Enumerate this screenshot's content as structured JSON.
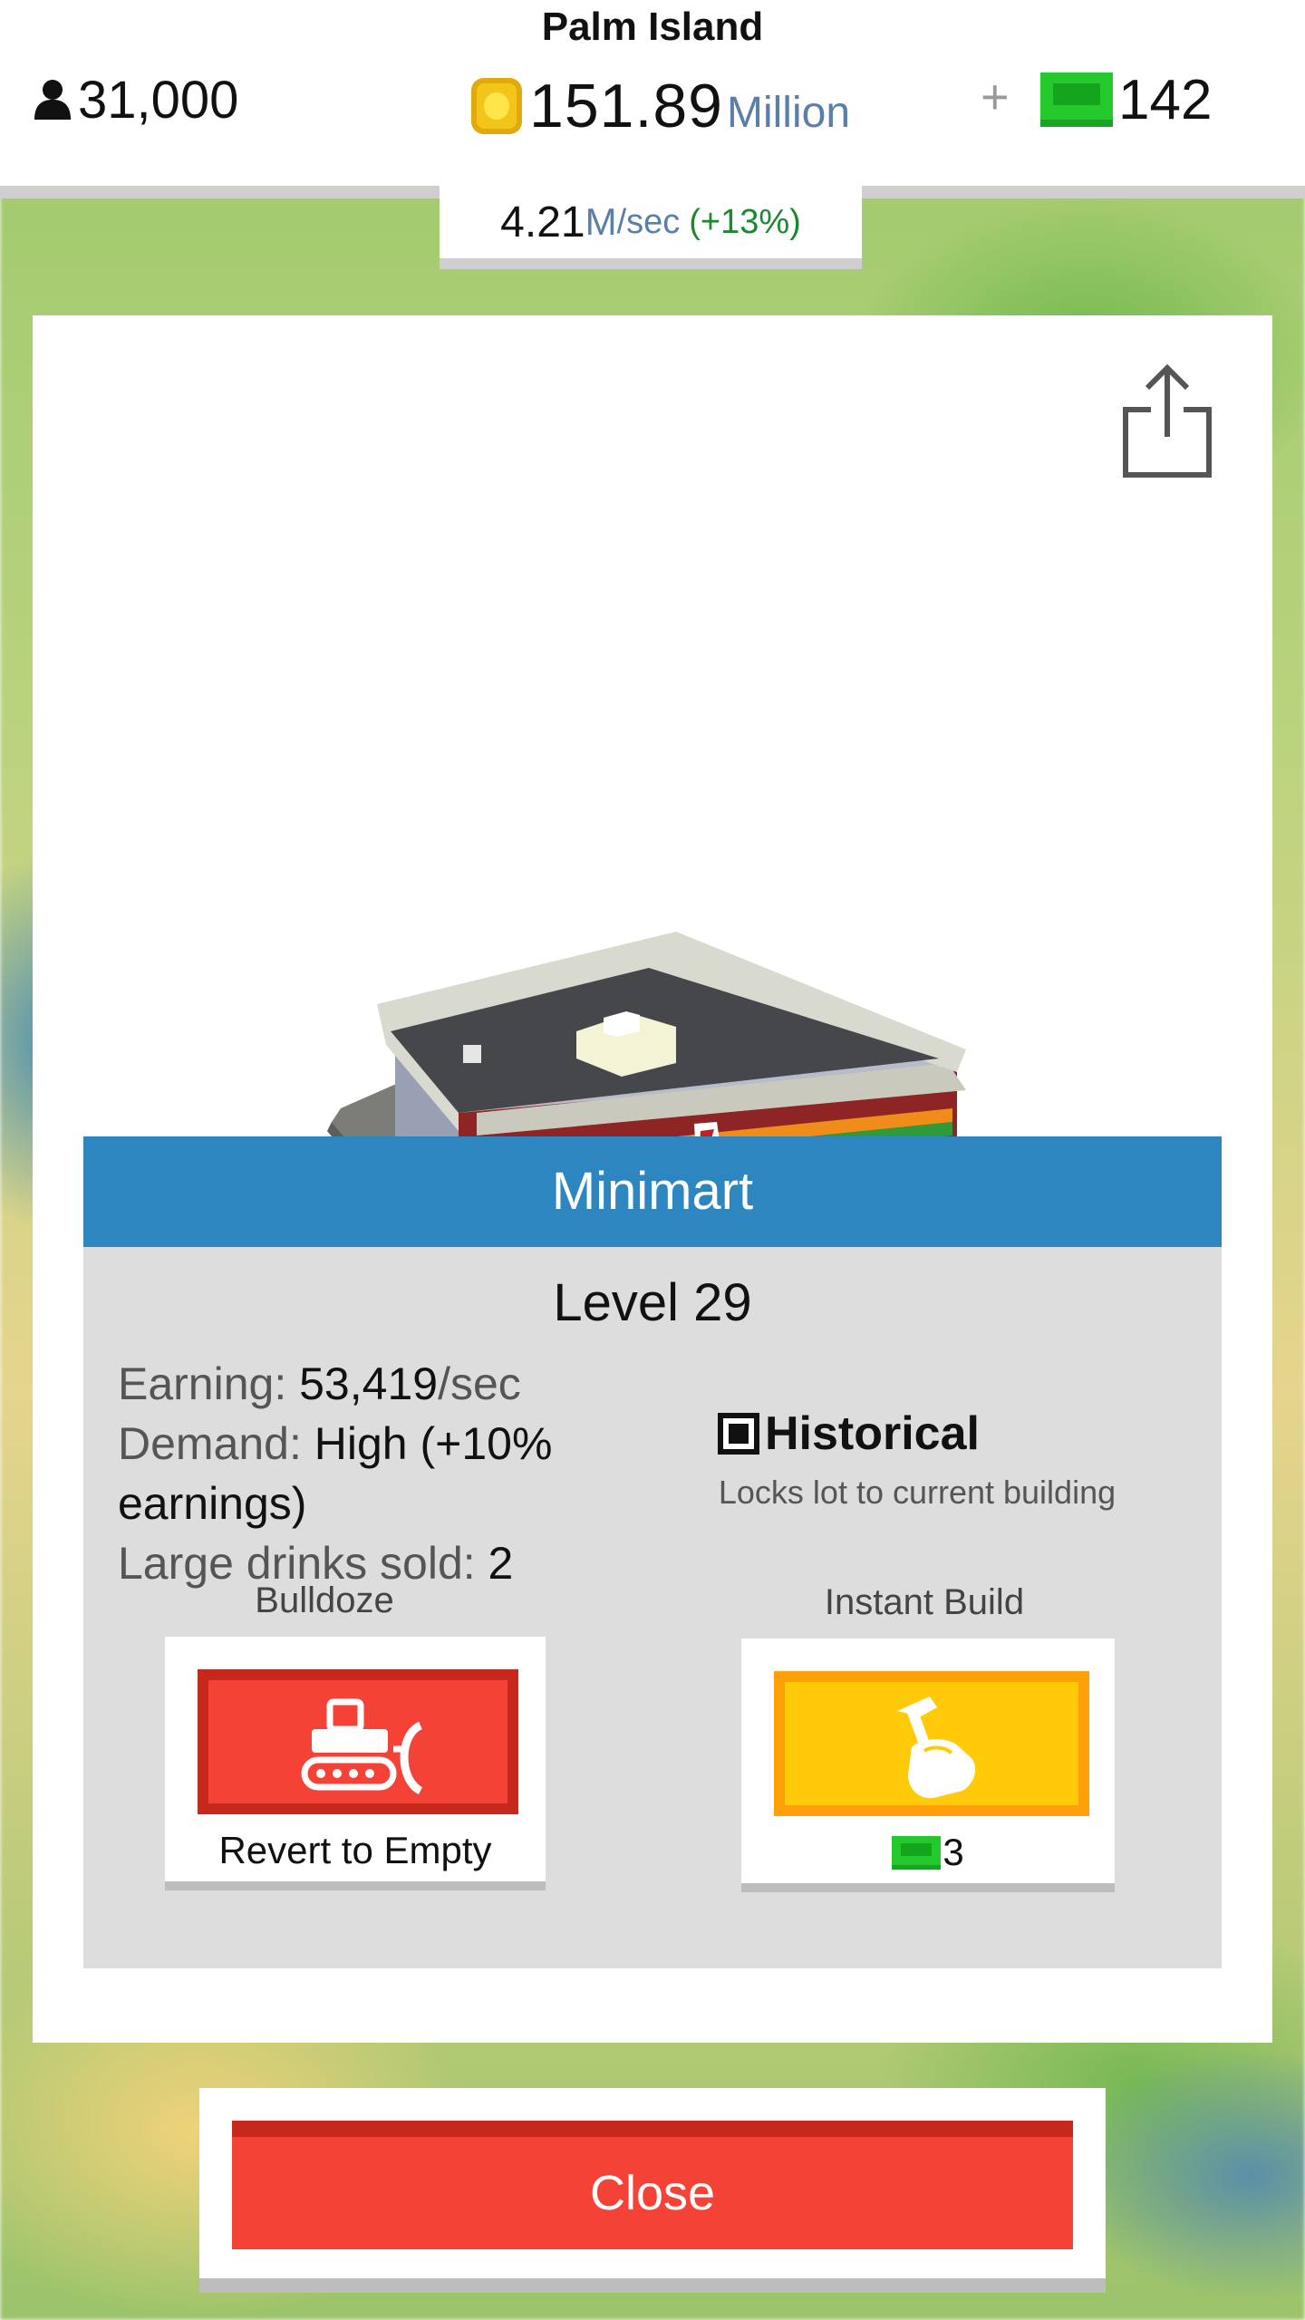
{
  "hud": {
    "island_name": "Palm Island",
    "population": "31,000",
    "money_value": "151.89",
    "money_unit": "Million",
    "plus": "+",
    "cash": "142",
    "rate_value": "4.21",
    "rate_unit_m": "M",
    "rate_unit_sec": "/sec",
    "rate_pct": "(+13%)"
  },
  "building": {
    "name": "Minimart",
    "level": "Level 29",
    "earning_label": "Earning: ",
    "earning_value": "53,419",
    "earning_unit": "/sec",
    "demand_label": "Demand: ",
    "demand_value": "High (+10% earnings)",
    "drinks_label": "Large drinks sold: ",
    "drinks_value": "2",
    "historical_label": "Historical",
    "historical_sub": "Locks lot to current building",
    "historical_checked": true
  },
  "actions": {
    "bulldoze_label": "Bulldoze",
    "bulldoze_caption": "Revert to Empty",
    "instant_label": "Instant Build",
    "instant_cost": "3"
  },
  "footer": {
    "close_label": "Close"
  },
  "colors": {
    "title_bar": "#2e86c1",
    "bulldoze": "#f44336",
    "instant": "#ffca0a",
    "cash_green": "#24c92e",
    "rate_green": "#1b8a2e",
    "unit_blue": "#5a7fa8"
  },
  "icons": {
    "population": "person-icon",
    "money": "coin-icon",
    "premium": "cash-icon",
    "share": "share-icon",
    "bulldoze": "bulldozer-icon",
    "instant": "hammer-hand-icon"
  }
}
